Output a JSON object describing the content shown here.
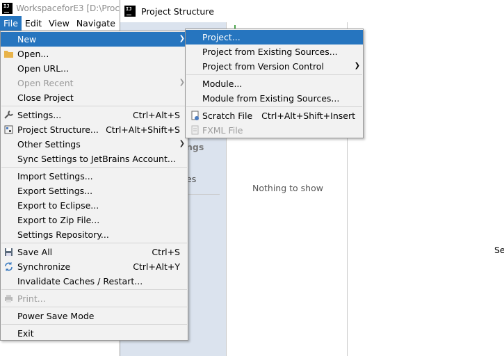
{
  "ide": {
    "title": "WorkspaceforE3 [D:\\Proc",
    "menubar": [
      "File",
      "Edit",
      "View",
      "Navigate"
    ]
  },
  "dialog": {
    "title": "Project Structure",
    "empty_text": "Nothing to show",
    "frag_left_1": "ngs",
    "frag_left_2": "es",
    "frag_right": "Se"
  },
  "file_menu": {
    "new": "New",
    "open": "Open...",
    "open_url": "Open URL...",
    "open_recent": "Open Recent",
    "close_project": "Close Project",
    "settings": "Settings...",
    "settings_sc": "Ctrl+Alt+S",
    "project_structure": "Project Structure...",
    "project_structure_sc": "Ctrl+Alt+Shift+S",
    "other_settings": "Other Settings",
    "sync_settings": "Sync Settings to JetBrains Account...",
    "import_settings": "Import Settings...",
    "export_settings": "Export Settings...",
    "export_eclipse": "Export to Eclipse...",
    "export_zip": "Export to Zip File...",
    "settings_repository": "Settings Repository...",
    "save_all": "Save All",
    "save_all_sc": "Ctrl+S",
    "synchronize": "Synchronize",
    "synchronize_sc": "Ctrl+Alt+Y",
    "invalidate_caches": "Invalidate Caches / Restart...",
    "print": "Print...",
    "power_save": "Power Save Mode",
    "exit": "Exit"
  },
  "new_submenu": {
    "project": "Project...",
    "project_existing": "Project from Existing Sources...",
    "project_vcs": "Project from Version Control",
    "module": "Module...",
    "module_existing": "Module from Existing Sources...",
    "scratch_file": "Scratch File",
    "scratch_file_sc": "Ctrl+Alt+Shift+Insert",
    "fxml_file": "FXML File"
  },
  "colors": {
    "selection": "#2675bf",
    "menu_bg": "#f2f2f2",
    "disabled": "#9a9a9a"
  }
}
